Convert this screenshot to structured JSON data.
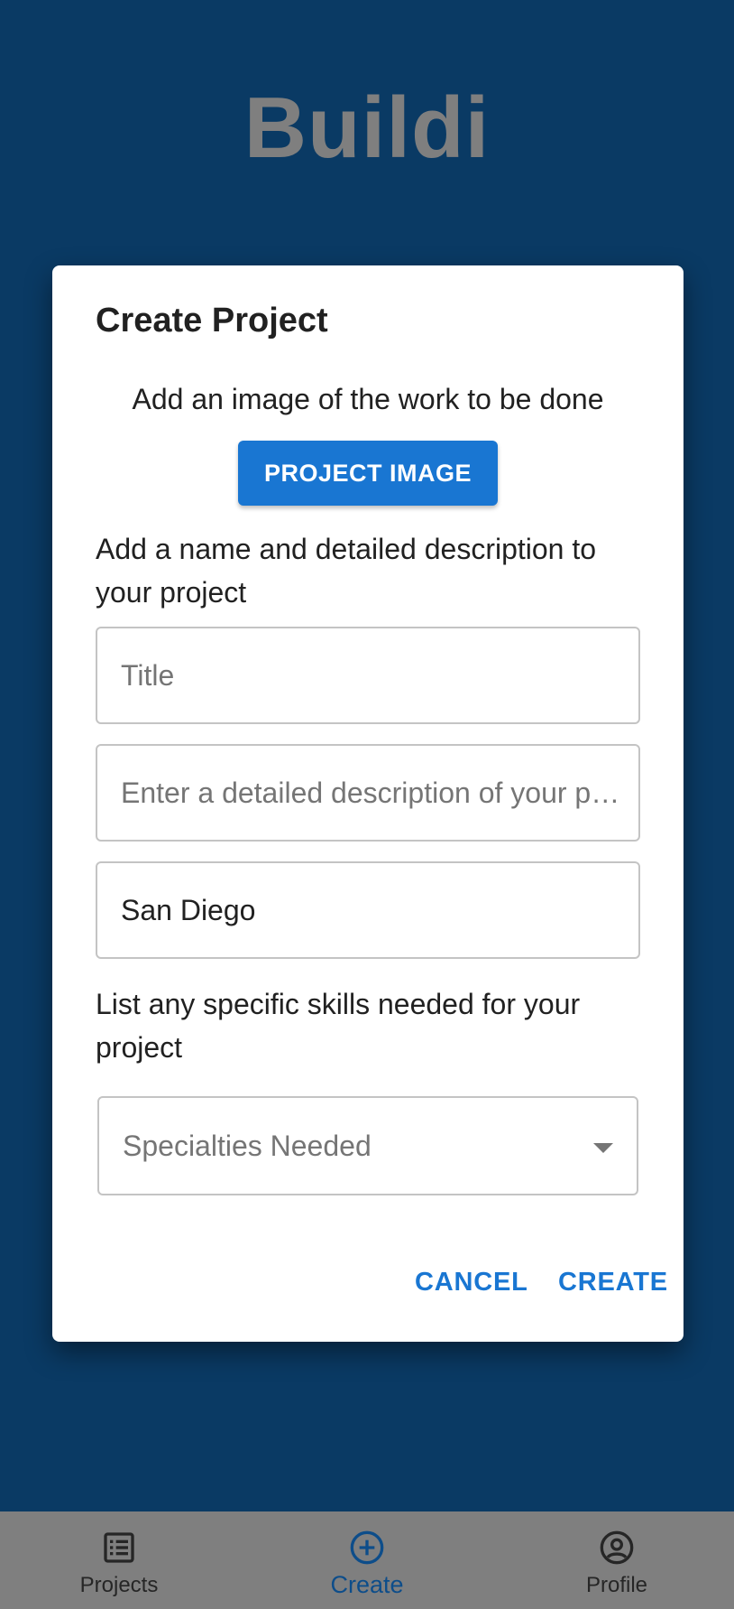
{
  "app": {
    "title": "Buildi"
  },
  "dialog": {
    "title": "Create Project",
    "image_prompt": "Add an image of the work to be done",
    "image_button_label": "PROJECT IMAGE",
    "details_prompt": "Add a name and detailed description to your project",
    "title_field": {
      "value": "",
      "placeholder": "Title"
    },
    "description_field": {
      "value": "",
      "placeholder": "Enter a detailed description of your p…"
    },
    "location_field": {
      "value": "San Diego",
      "placeholder": ""
    },
    "skills_prompt": "List any specific skills needed for your project",
    "specialties_select": {
      "placeholder": "Specialties Needed"
    },
    "cancel_label": "CANCEL",
    "create_label": "CREATE"
  },
  "bottom_nav": {
    "items": [
      {
        "label": "Projects",
        "icon": "list-icon",
        "active": false
      },
      {
        "label": "Create",
        "icon": "add-circle-icon",
        "active": true
      },
      {
        "label": "Profile",
        "icon": "account-circle-icon",
        "active": false
      }
    ]
  },
  "colors": {
    "background": "#0a3a64",
    "primary": "#1976d2",
    "bottom_nav": "#7f7f7f",
    "active_nav": "#0d4d8a"
  }
}
